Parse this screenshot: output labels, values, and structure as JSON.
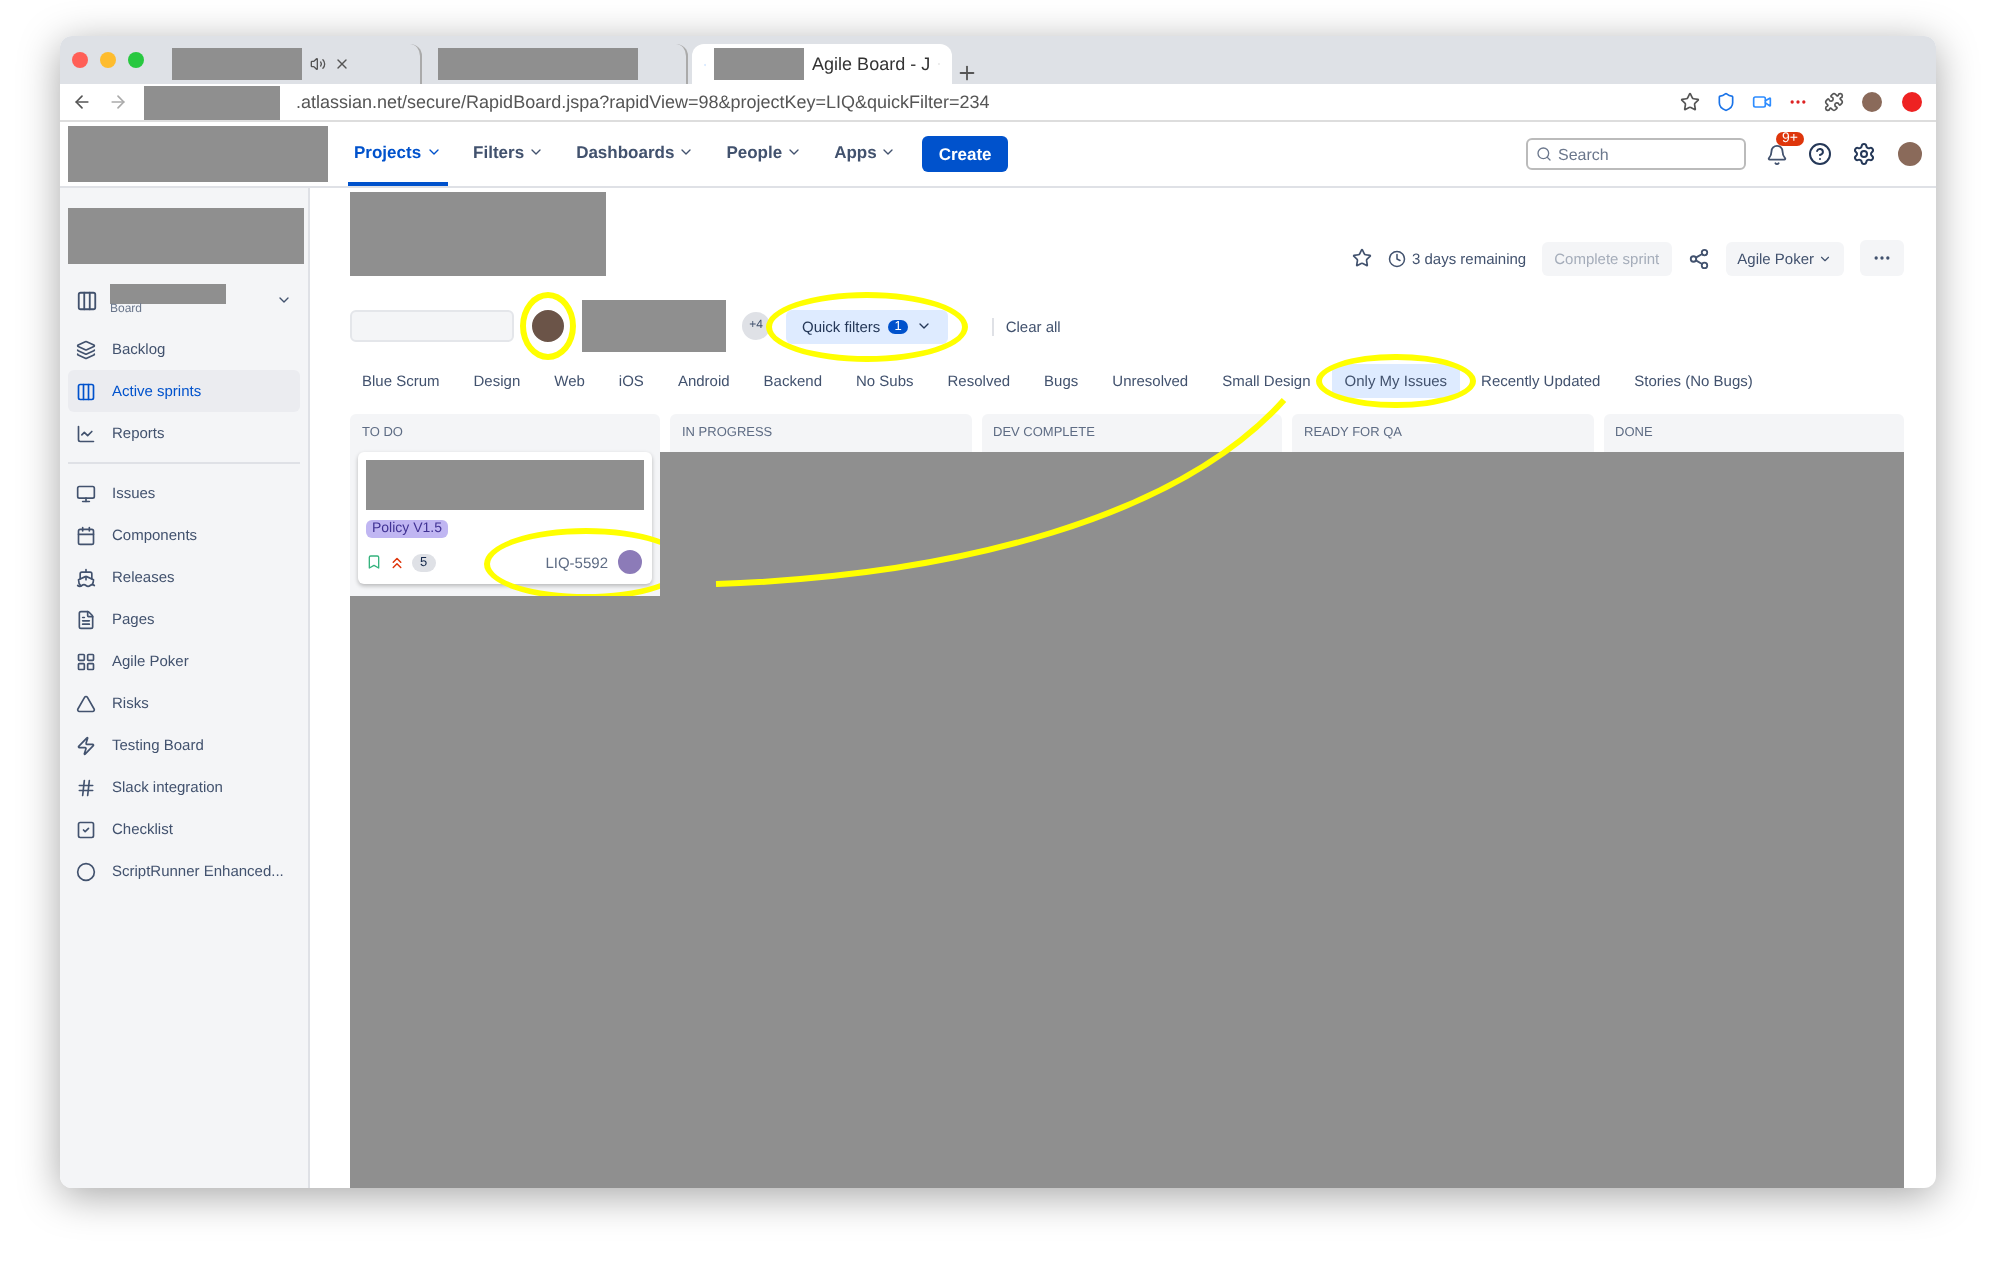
{
  "browser": {
    "tabs": [
      {
        "selected": false,
        "audio": true
      },
      {
        "selected": false,
        "audio": false
      },
      {
        "title": "Agile Board - J",
        "selected": true,
        "audio": false
      }
    ],
    "address": ".atlassian.net/secure/RapidBoard.jspa?rapidView=98&projectKey=LIQ&quickFilter=234"
  },
  "nav": {
    "items": [
      {
        "label": "Projects",
        "selected": true
      },
      {
        "label": "Filters",
        "selected": false
      },
      {
        "label": "Dashboards",
        "selected": false
      },
      {
        "label": "People",
        "selected": false
      },
      {
        "label": "Apps",
        "selected": false
      }
    ],
    "create": "Create",
    "search": {
      "placeholder": "Search"
    },
    "notifications": "9+"
  },
  "sidebar": {
    "board_label": "Board",
    "items": [
      {
        "label": "Backlog",
        "selected": false
      },
      {
        "label": "Active sprints",
        "selected": true
      },
      {
        "label": "Reports",
        "selected": false
      },
      {
        "label": "Issues",
        "selected": false
      },
      {
        "label": "Components",
        "selected": false
      },
      {
        "label": "Releases",
        "selected": false
      },
      {
        "label": "Pages",
        "selected": false
      },
      {
        "label": "Agile Poker",
        "selected": false
      },
      {
        "label": "Risks",
        "selected": false
      },
      {
        "label": "Testing Board",
        "selected": false
      },
      {
        "label": "Slack integration",
        "selected": false
      },
      {
        "label": "Checklist",
        "selected": false
      },
      {
        "label": "ScriptRunner Enhanced...",
        "selected": false
      }
    ]
  },
  "header": {
    "remaining": "3 days remaining",
    "complete": {
      "label": "Complete sprint",
      "disabled": true
    },
    "poker": "Agile Poker"
  },
  "toolbar": {
    "more_people": "+4",
    "quick_filters": "Quick filters",
    "quick_count": "1",
    "clear": "Clear all"
  },
  "filters": [
    {
      "label": "Blue Scrum",
      "selected": false
    },
    {
      "label": "Design",
      "selected": false
    },
    {
      "label": "Web",
      "selected": false
    },
    {
      "label": "iOS",
      "selected": false
    },
    {
      "label": "Android",
      "selected": false
    },
    {
      "label": "Backend",
      "selected": false
    },
    {
      "label": "No Subs",
      "selected": false
    },
    {
      "label": "Resolved",
      "selected": false
    },
    {
      "label": "Bugs",
      "selected": false
    },
    {
      "label": "Unresolved",
      "selected": false
    },
    {
      "label": "Small Design",
      "selected": false
    },
    {
      "label": "Only My Issues",
      "selected": true
    },
    {
      "label": "Recently Updated",
      "selected": false
    },
    {
      "label": "Stories (No Bugs)",
      "selected": false
    }
  ],
  "columns": [
    "TO DO",
    "IN PROGRESS",
    "DEV COMPLETE",
    "READY FOR QA",
    "DONE"
  ],
  "card": {
    "epic": "Policy V1.5",
    "points": "5",
    "key": "LIQ-5592"
  }
}
